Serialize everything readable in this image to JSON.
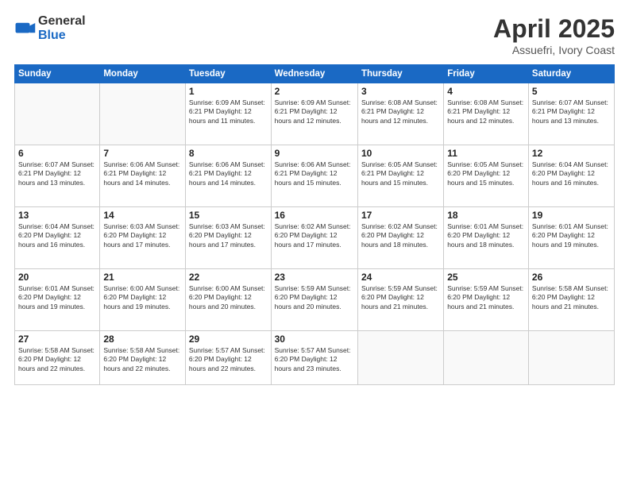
{
  "logo": {
    "general": "General",
    "blue": "Blue"
  },
  "title": "April 2025",
  "subtitle": "Assuefri, Ivory Coast",
  "days_header": [
    "Sunday",
    "Monday",
    "Tuesday",
    "Wednesday",
    "Thursday",
    "Friday",
    "Saturday"
  ],
  "weeks": [
    [
      {
        "day": "",
        "info": ""
      },
      {
        "day": "",
        "info": ""
      },
      {
        "day": "1",
        "info": "Sunrise: 6:09 AM\nSunset: 6:21 PM\nDaylight: 12 hours and 11 minutes."
      },
      {
        "day": "2",
        "info": "Sunrise: 6:09 AM\nSunset: 6:21 PM\nDaylight: 12 hours and 12 minutes."
      },
      {
        "day": "3",
        "info": "Sunrise: 6:08 AM\nSunset: 6:21 PM\nDaylight: 12 hours and 12 minutes."
      },
      {
        "day": "4",
        "info": "Sunrise: 6:08 AM\nSunset: 6:21 PM\nDaylight: 12 hours and 12 minutes."
      },
      {
        "day": "5",
        "info": "Sunrise: 6:07 AM\nSunset: 6:21 PM\nDaylight: 12 hours and 13 minutes."
      }
    ],
    [
      {
        "day": "6",
        "info": "Sunrise: 6:07 AM\nSunset: 6:21 PM\nDaylight: 12 hours and 13 minutes."
      },
      {
        "day": "7",
        "info": "Sunrise: 6:06 AM\nSunset: 6:21 PM\nDaylight: 12 hours and 14 minutes."
      },
      {
        "day": "8",
        "info": "Sunrise: 6:06 AM\nSunset: 6:21 PM\nDaylight: 12 hours and 14 minutes."
      },
      {
        "day": "9",
        "info": "Sunrise: 6:06 AM\nSunset: 6:21 PM\nDaylight: 12 hours and 15 minutes."
      },
      {
        "day": "10",
        "info": "Sunrise: 6:05 AM\nSunset: 6:21 PM\nDaylight: 12 hours and 15 minutes."
      },
      {
        "day": "11",
        "info": "Sunrise: 6:05 AM\nSunset: 6:20 PM\nDaylight: 12 hours and 15 minutes."
      },
      {
        "day": "12",
        "info": "Sunrise: 6:04 AM\nSunset: 6:20 PM\nDaylight: 12 hours and 16 minutes."
      }
    ],
    [
      {
        "day": "13",
        "info": "Sunrise: 6:04 AM\nSunset: 6:20 PM\nDaylight: 12 hours and 16 minutes."
      },
      {
        "day": "14",
        "info": "Sunrise: 6:03 AM\nSunset: 6:20 PM\nDaylight: 12 hours and 17 minutes."
      },
      {
        "day": "15",
        "info": "Sunrise: 6:03 AM\nSunset: 6:20 PM\nDaylight: 12 hours and 17 minutes."
      },
      {
        "day": "16",
        "info": "Sunrise: 6:02 AM\nSunset: 6:20 PM\nDaylight: 12 hours and 17 minutes."
      },
      {
        "day": "17",
        "info": "Sunrise: 6:02 AM\nSunset: 6:20 PM\nDaylight: 12 hours and 18 minutes."
      },
      {
        "day": "18",
        "info": "Sunrise: 6:01 AM\nSunset: 6:20 PM\nDaylight: 12 hours and 18 minutes."
      },
      {
        "day": "19",
        "info": "Sunrise: 6:01 AM\nSunset: 6:20 PM\nDaylight: 12 hours and 19 minutes."
      }
    ],
    [
      {
        "day": "20",
        "info": "Sunrise: 6:01 AM\nSunset: 6:20 PM\nDaylight: 12 hours and 19 minutes."
      },
      {
        "day": "21",
        "info": "Sunrise: 6:00 AM\nSunset: 6:20 PM\nDaylight: 12 hours and 19 minutes."
      },
      {
        "day": "22",
        "info": "Sunrise: 6:00 AM\nSunset: 6:20 PM\nDaylight: 12 hours and 20 minutes."
      },
      {
        "day": "23",
        "info": "Sunrise: 5:59 AM\nSunset: 6:20 PM\nDaylight: 12 hours and 20 minutes."
      },
      {
        "day": "24",
        "info": "Sunrise: 5:59 AM\nSunset: 6:20 PM\nDaylight: 12 hours and 21 minutes."
      },
      {
        "day": "25",
        "info": "Sunrise: 5:59 AM\nSunset: 6:20 PM\nDaylight: 12 hours and 21 minutes."
      },
      {
        "day": "26",
        "info": "Sunrise: 5:58 AM\nSunset: 6:20 PM\nDaylight: 12 hours and 21 minutes."
      }
    ],
    [
      {
        "day": "27",
        "info": "Sunrise: 5:58 AM\nSunset: 6:20 PM\nDaylight: 12 hours and 22 minutes."
      },
      {
        "day": "28",
        "info": "Sunrise: 5:58 AM\nSunset: 6:20 PM\nDaylight: 12 hours and 22 minutes."
      },
      {
        "day": "29",
        "info": "Sunrise: 5:57 AM\nSunset: 6:20 PM\nDaylight: 12 hours and 22 minutes."
      },
      {
        "day": "30",
        "info": "Sunrise: 5:57 AM\nSunset: 6:20 PM\nDaylight: 12 hours and 23 minutes."
      },
      {
        "day": "",
        "info": ""
      },
      {
        "day": "",
        "info": ""
      },
      {
        "day": "",
        "info": ""
      }
    ]
  ]
}
